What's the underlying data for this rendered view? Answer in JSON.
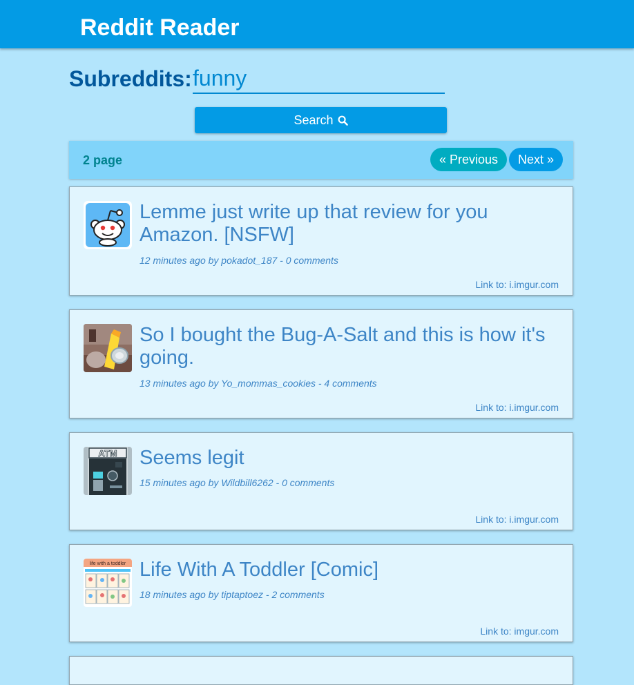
{
  "header": {
    "title": "Reddit Reader"
  },
  "search": {
    "label": "Subreddits:",
    "value": "funny",
    "button_label": "Search"
  },
  "pager": {
    "page_label": "2 page",
    "previous_label": "« Previous",
    "next_label": "Next »"
  },
  "posts": [
    {
      "title": "Lemme just write up that review for you Amazon. [NSFW]",
      "meta": "12 minutes ago by pokadot_187 - 0 comments",
      "link_prefix": "Link to:",
      "link_domain": "i.imgur.com",
      "thumb": "reddit-alien-icon"
    },
    {
      "title": "So I bought the Bug-A-Salt and this is how it's going.",
      "meta": "13 minutes ago by Yo_mommas_cookies - 4 comments",
      "link_prefix": "Link to:",
      "link_domain": "i.imgur.com",
      "thumb": "bug-a-salt-photo"
    },
    {
      "title": "Seems legit",
      "meta": "15 minutes ago by Wildbill6262 - 0 comments",
      "link_prefix": "Link to:",
      "link_domain": "i.imgur.com",
      "thumb": "atm-photo",
      "thumb_text": "ATM"
    },
    {
      "title": "Life With A Toddler [Comic]",
      "meta": "18 minutes ago by tiptaptoez - 2 comments",
      "link_prefix": "Link to:",
      "link_domain": "imgur.com",
      "thumb": "comic-thumbnail",
      "thumb_text": "life with a toddler"
    }
  ],
  "colors": {
    "background": "#b3e5fc",
    "header": "#039be5",
    "accent_dark": "#01579b",
    "link": "#3d85c6",
    "card": "#e1f5fe",
    "pager_bar": "#81d4fa",
    "previous_button": "#00acc1"
  }
}
